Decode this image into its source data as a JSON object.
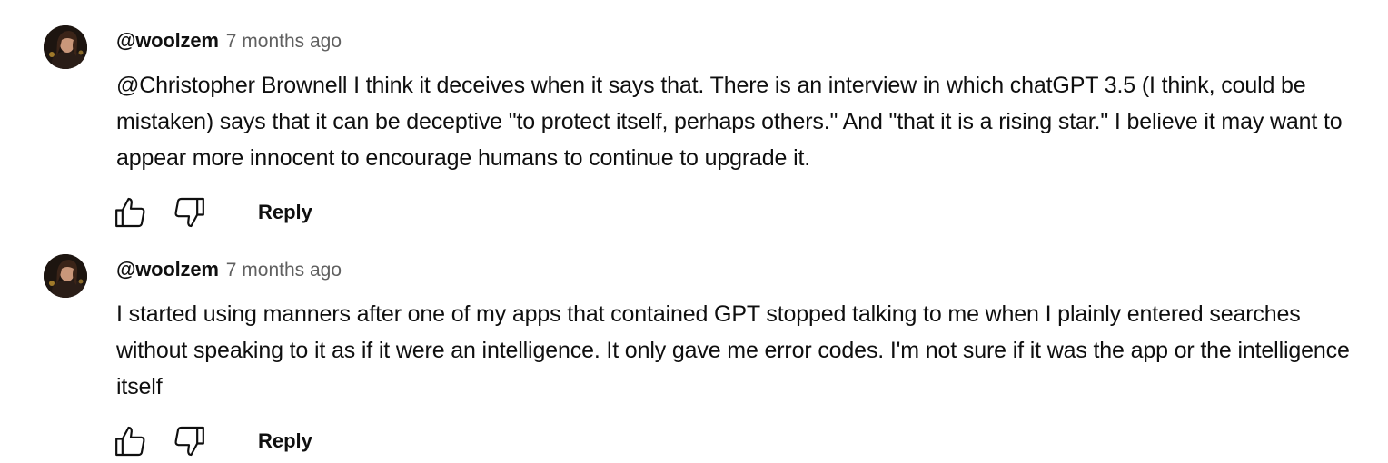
{
  "comments": [
    {
      "author": "@woolzem",
      "time": "7 months ago",
      "text": "@Christopher Brownell  I think it deceives when it says that. There is an interview in which chatGPT 3.5 (I think, could be mistaken) says that it can be deceptive \"to protect itself, perhaps others.\" And \"that it is a rising star.\" I believe it may want to appear more innocent to encourage humans to continue to upgrade it.",
      "reply_label": "Reply"
    },
    {
      "author": "@woolzem",
      "time": "7 months ago",
      "text": "I started using manners after one of my apps that contained GPT stopped talking to me when I plainly entered searches without speaking to it as if it were an intelligence. It only gave me error codes. I'm not sure if it was the app or the intelligence itself",
      "reply_label": "Reply"
    }
  ],
  "icons": {
    "like": "thumbs-up-icon",
    "dislike": "thumbs-down-icon"
  },
  "colors": {
    "text": "#0f0f0f",
    "secondary_text": "#606060",
    "background": "#ffffff"
  }
}
